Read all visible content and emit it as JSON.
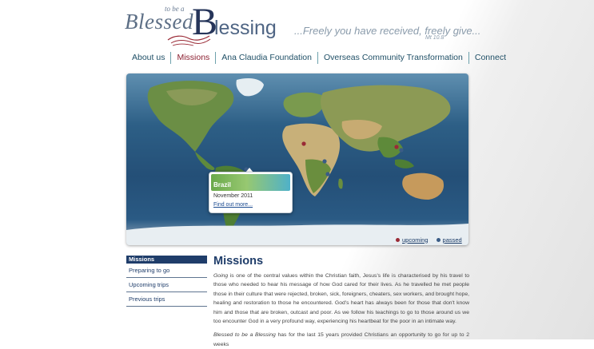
{
  "header": {
    "logo": {
      "blessed": "Blessed",
      "to_be_a": "to be a",
      "b": "B",
      "lessing": "lessing"
    },
    "tagline": "...Freely you have received, freely give...",
    "tagline_ref": "Mt 10.8"
  },
  "nav": {
    "items": [
      {
        "label": "About us"
      },
      {
        "label": "Missions"
      },
      {
        "label": "Ana Claudia Foundation"
      },
      {
        "label": "Overseas Community Transformation"
      },
      {
        "label": "Connect"
      }
    ],
    "active": "Missions"
  },
  "map": {
    "popup": {
      "title": "Brazil",
      "date": "November 2011",
      "link": "Find out more..."
    },
    "legend": {
      "upcoming": "upcoming",
      "passed": "passed"
    },
    "colors": {
      "upcoming": "#9a2a36",
      "passed": "#3a5c86"
    }
  },
  "sidebar": {
    "heading": "Missions",
    "items": [
      {
        "label": "Preparing to go"
      },
      {
        "label": "Upcoming trips"
      },
      {
        "label": "Previous trips"
      }
    ]
  },
  "content": {
    "heading": "Missions",
    "p1_lead": "Going",
    "p1_rest": " is one of the central values within the Christian faith, Jesus's life is characterised by his travel to those who needed to hear his message of how God cared for their lives. As he travelled he met people those in their culture that were rejected, broken, sick, foreigners, cheaters, sex workers, and brought hope, healing and restoration to those he encountered. God's heart has always been for those that don't know him and those that are broken, outcast and poor. As we follow his teachings to go to those around us we too encounter God in a very profound way, experiencing his heartbeat for the poor in an intimate way.",
    "p2_lead": "Blessed to be a Blessing",
    "p2_rest": " has for the last 15 years provided Christians an opportunity to go for up to 2 weeks"
  }
}
